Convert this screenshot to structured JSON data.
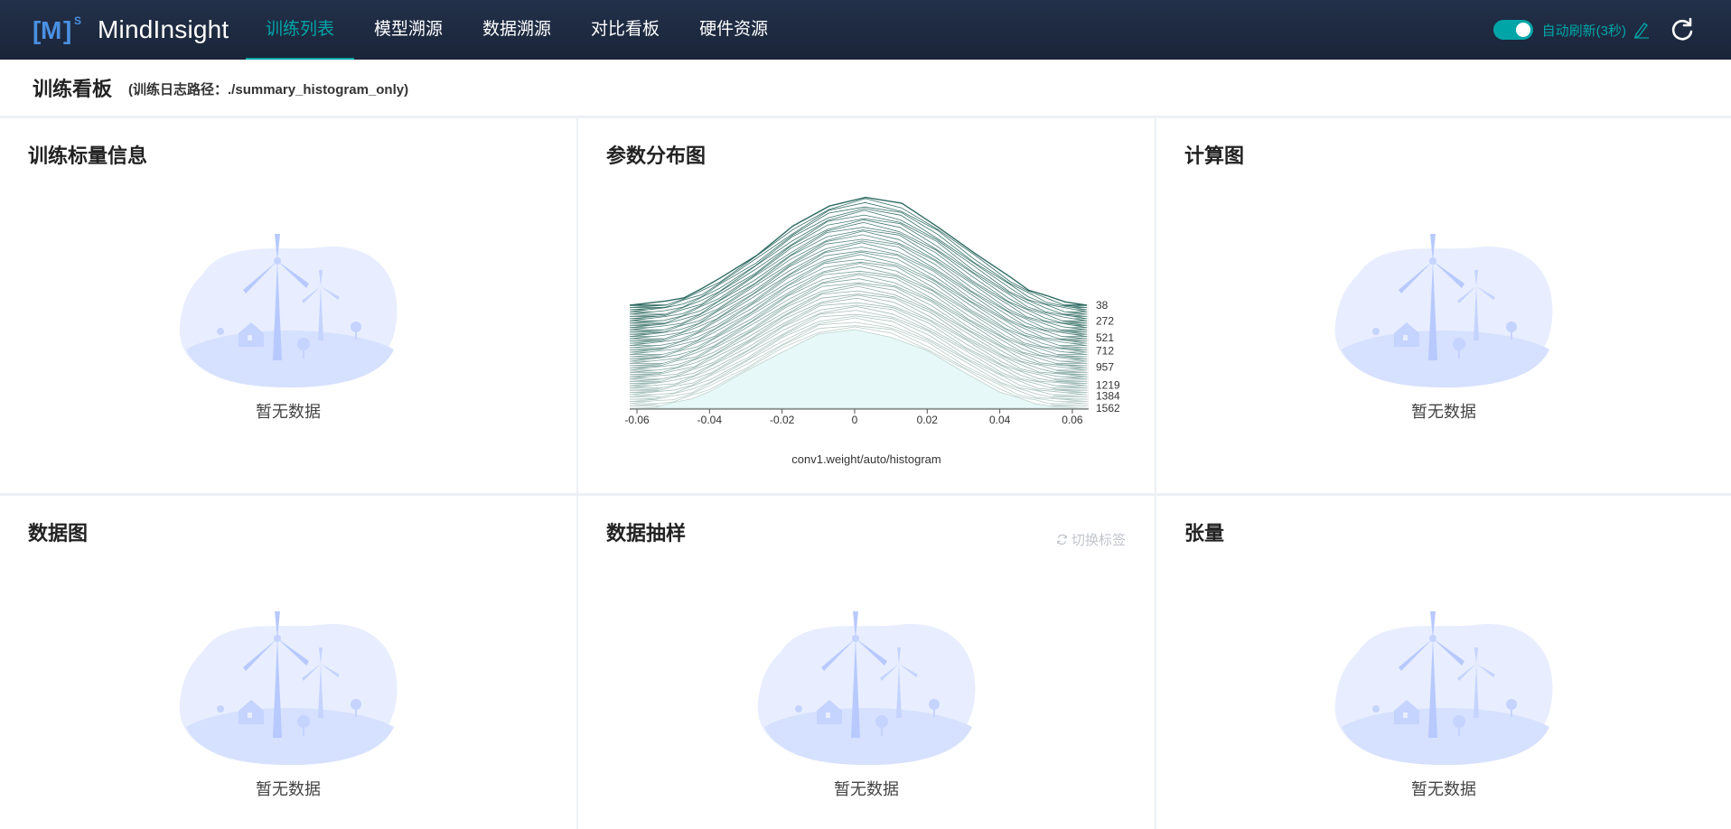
{
  "app": {
    "name": "MindInsight",
    "logo_text": "M",
    "logo_sup": "S"
  },
  "nav": {
    "items": [
      {
        "label": "训练列表",
        "active": true
      },
      {
        "label": "模型溯源",
        "active": false
      },
      {
        "label": "数据溯源",
        "active": false
      },
      {
        "label": "对比看板",
        "active": false
      },
      {
        "label": "硬件资源",
        "active": false
      }
    ]
  },
  "refresh": {
    "label": "自动刷新(3秒)",
    "enabled": true,
    "edit_icon": "edit-icon",
    "reload_icon": "refresh-icon"
  },
  "header": {
    "title": "训练看板",
    "log_path": "(训练日志路径：./summary_histogram_only)"
  },
  "cards": {
    "scalar": {
      "title": "训练标量信息",
      "empty_text": "暂无数据"
    },
    "histogram": {
      "title": "参数分布图",
      "tag": "conv1.weight/auto/histogram"
    },
    "graph": {
      "title": "计算图",
      "empty_text": "暂无数据"
    },
    "dataset_graph": {
      "title": "数据图",
      "empty_text": "暂无数据"
    },
    "image": {
      "title": "数据抽样",
      "empty_text": "暂无数据",
      "switch_label": "切换标签"
    },
    "tensor": {
      "title": "张量",
      "empty_text": "暂无数据"
    }
  },
  "colors": {
    "accent": "#00a5a7",
    "topbar": "#1f2b40",
    "fill": "#e6f9f8",
    "stroke": "#2f6b63"
  },
  "chart_data": {
    "type": "area",
    "title": "conv1.weight/auto/histogram",
    "x_ticks": [
      "-0.06",
      "-0.04",
      "-0.02",
      "0",
      "0.02",
      "0.04",
      "0.06"
    ],
    "x_range": [
      -0.062,
      0.064
    ],
    "step_labels": [
      "38",
      "272",
      "521",
      "712",
      "957",
      "1219",
      "1384",
      "1562"
    ],
    "step_range": [
      38,
      1562
    ],
    "distribution": {
      "x": [
        -0.062,
        -0.055,
        -0.05,
        -0.045,
        -0.04,
        -0.03,
        -0.02,
        -0.01,
        0,
        0.01,
        0.02,
        0.03,
        0.04,
        0.045,
        0.05,
        0.055,
        0.064
      ],
      "y_first": [
        0,
        0.02,
        0.05,
        0.1,
        0.18,
        0.38,
        0.6,
        0.78,
        0.82,
        0.76,
        0.6,
        0.38,
        0.18,
        0.1,
        0.05,
        0.02,
        0
      ],
      "y_last": [
        0,
        0.03,
        0.08,
        0.15,
        0.25,
        0.47,
        0.72,
        0.92,
        1.0,
        0.93,
        0.73,
        0.48,
        0.25,
        0.15,
        0.08,
        0.03,
        0
      ]
    }
  }
}
